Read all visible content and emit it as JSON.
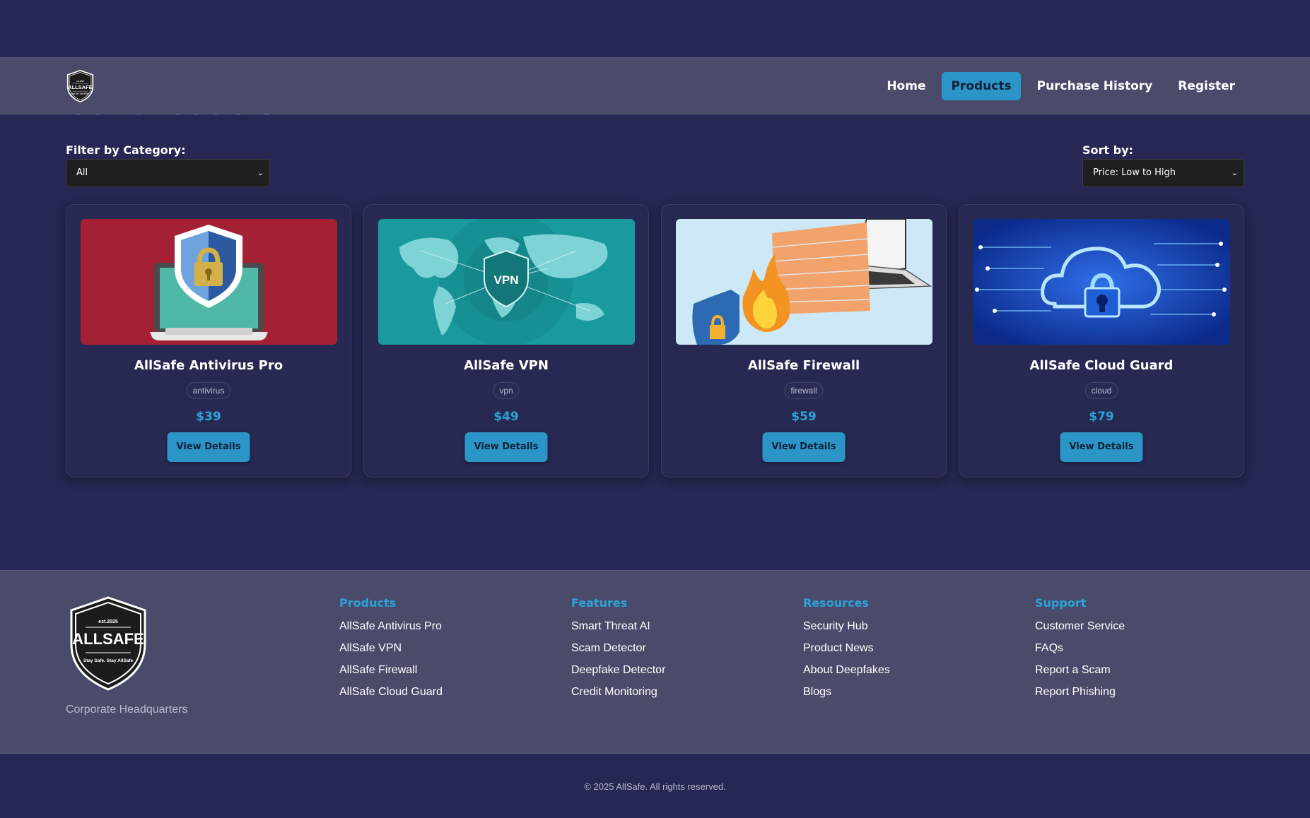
{
  "brand": {
    "logo_top": "est.2025",
    "logo_name": "ALLSAFE",
    "logo_tagline": "Stay Safe. Stay AllSafe"
  },
  "page_heading": "Our Products",
  "nav": {
    "items": [
      {
        "label": "Home",
        "active": false
      },
      {
        "label": "Products",
        "active": true
      },
      {
        "label": "Purchase History",
        "active": false
      },
      {
        "label": "Register",
        "active": false
      }
    ]
  },
  "filters": {
    "category_label": "Filter by Category:",
    "category_value": "All",
    "sort_label": "Sort by:",
    "sort_value": "Price: Low to High"
  },
  "products": [
    {
      "name": "AllSafe Antivirus Pro",
      "category": "antivirus",
      "price": "$39",
      "button": "View Details",
      "image": "laptop-shield-lock"
    },
    {
      "name": "AllSafe VPN",
      "category": "vpn",
      "price": "$49",
      "button": "View Details",
      "image": "world-map-vpn-shield"
    },
    {
      "name": "AllSafe Firewall",
      "category": "firewall",
      "price": "$59",
      "button": "View Details",
      "image": "firewall-laptop-flame"
    },
    {
      "name": "AllSafe Cloud Guard",
      "category": "cloud",
      "price": "$79",
      "button": "View Details",
      "image": "cloud-lock-circuit"
    }
  ],
  "footer": {
    "hq": "Corporate Headquarters",
    "columns": [
      {
        "title": "Products",
        "links": [
          "AllSafe Antivirus Pro",
          "AllSafe VPN",
          "AllSafe Firewall",
          "AllSafe Cloud Guard"
        ]
      },
      {
        "title": "Features",
        "links": [
          "Smart Threat AI",
          "Scam Detector",
          "Deepfake Detector",
          "Credit Monitoring"
        ]
      },
      {
        "title": "Resources",
        "links": [
          "Security Hub",
          "Product News",
          "About Deepfakes",
          "Blogs"
        ]
      },
      {
        "title": "Support",
        "links": [
          "Customer Service",
          "FAQs",
          "Report a Scam",
          "Report Phishing"
        ]
      }
    ],
    "copyright": "© 2025 AllSafe. All rights reserved."
  },
  "colors": {
    "background": "#262752",
    "header": "#4a4b6b",
    "accent": "#2aa3d8",
    "button": "#2b95c7"
  }
}
